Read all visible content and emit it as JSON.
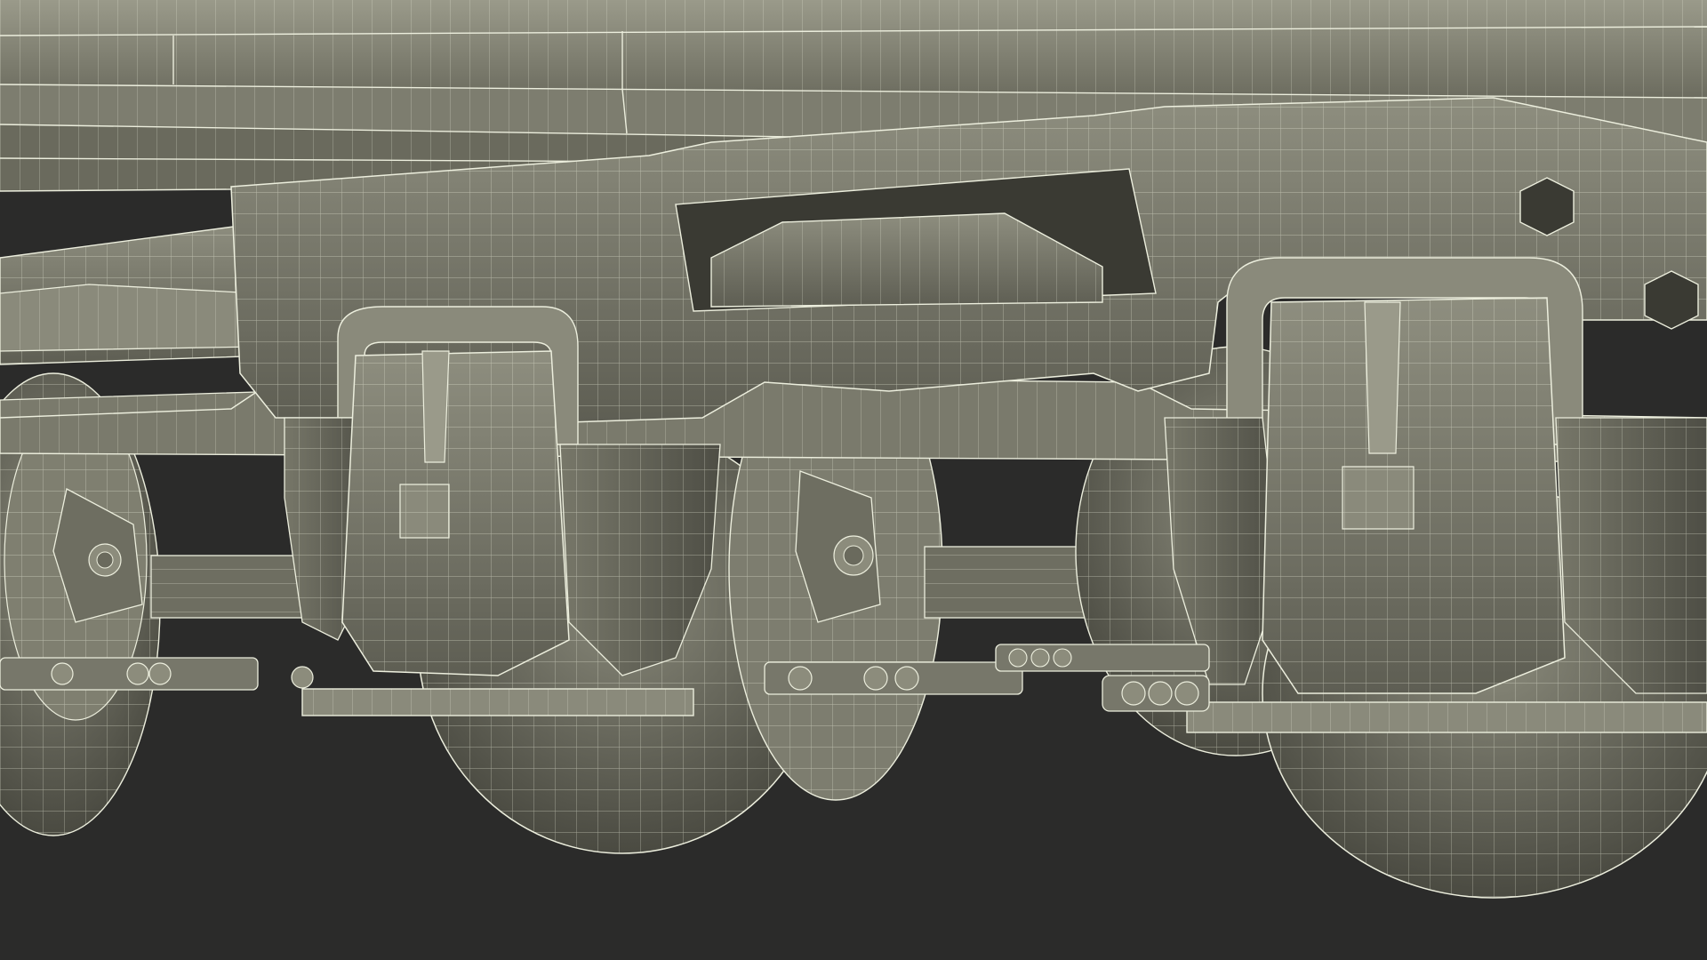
{
  "viewport": {
    "render_mode": "wireframe-on-shaded",
    "subject": "railway-bogie-undercarriage"
  },
  "colors": {
    "background": "#2b2b2a",
    "surface_light": "#8d8d7e",
    "surface_mid": "#6f6f62",
    "surface_dark": "#4e4e44",
    "surface_deep": "#38382f",
    "wire": "#eceedd"
  },
  "grid": {
    "type": "wireframe-mesh",
    "visible": true
  },
  "icons": {
    "hex_bolt": "hexagon-icon",
    "bearing": "bearing-icon"
  }
}
